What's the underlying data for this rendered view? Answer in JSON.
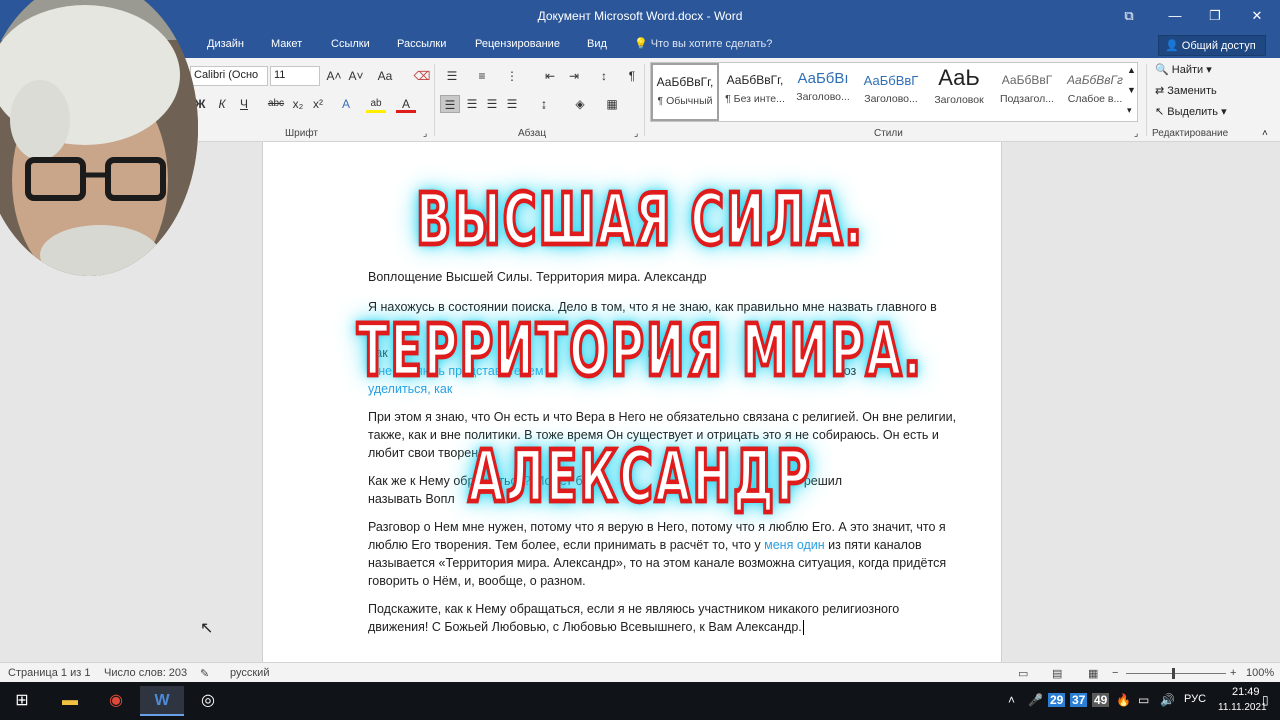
{
  "window": {
    "title": "Документ Microsoft Word.docx - Word",
    "controls": [
      "⧉",
      "—",
      "❐",
      "✕"
    ]
  },
  "tabs": {
    "items": [
      "Дизайн",
      "Макет",
      "Ссылки",
      "Рассылки",
      "Рецензирование",
      "Вид"
    ],
    "tell_me": "Что вы хотите сделать?",
    "share": "Общий доступ"
  },
  "ribbon": {
    "font": {
      "name": "Calibri (Осно",
      "size": "11",
      "label": "Шрифт",
      "grow": "A˄",
      "shrink": "A˅",
      "case": "Aa",
      "bold": "Ж",
      "italic": "К",
      "underline": "Ч",
      "strike": "abc",
      "sub": "x₂",
      "sup": "x²",
      "effects": "A",
      "highlight": "ab",
      "color": "A"
    },
    "paragraph": {
      "label": "Абзац",
      "marks": "¶"
    },
    "styles": {
      "label": "Стили",
      "items": [
        {
          "sample": "АаБбВвГг,",
          "name": "¶ Обычный"
        },
        {
          "sample": "АаБбВвГг,",
          "name": "¶ Без инте..."
        },
        {
          "sample": "АаБбВı",
          "name": "Заголово..."
        },
        {
          "sample": "АаБбВвГ",
          "name": "Заголово..."
        },
        {
          "sample": "АаЬ",
          "name": "Заголовок"
        },
        {
          "sample": "АаБбВвГ",
          "name": "Подзагол..."
        },
        {
          "sample": "АаБбВвГг",
          "name": "Слабое в..."
        }
      ]
    },
    "editing": {
      "label": "Редактирование",
      "find": "Найти",
      "replace": "Заменить",
      "select": "Выделить"
    }
  },
  "document": {
    "p1": "Воплощение Высшей Силы. Территория мира. Александр",
    "p2": "Я нахожусь в состоянии поиска. Дело в том, что я не знаю, как правильно мне назвать главного в",
    "p3a": "Как",
    "p3b": "к Не",
    "p3c": "я не являюсь представителем",
    "p3d": "поз",
    "p3e": "уделиться, как",
    "p4": "При этом я знаю, что Он есть и что Вера в Него не обязательно связана с религией. Он вне религии, также, как и вне политики. В тоже время Он существует и отрицать это я не собираюсь. Он есть и любит свои творения.",
    "p5a": "Как же к Нему обращаться? Может быть,",
    "p5b": "Его решил",
    "p5c": "называть Вопл",
    "p6a": "Разговор о Нем мне нужен, потому что я верую в Него, потому что я люблю Его. А это значит, что я люблю Его творения. Тем более, если принимать в расчёт то, что у",
    "p6b": "меня один",
    "p6c": "из пяти каналов называется «Территория мира. Александр», то на этом канале возможна ситуация, когда придётся говорить о Нём, и, вообще, о разном.",
    "p7": "Подскажите, как к Нему обращаться, если я не являюсь участником никакого религиозного движения! С Божьей Любовью, с Любовью Всевышнего, к Вам Александр."
  },
  "banner": {
    "line1": "ВЫСШАЯ  СИЛА.",
    "line2": "ТЕРРИТОРИЯ  МИРА.",
    "line3": "АЛЕКСАНДР"
  },
  "status": {
    "page": "Страница 1 из 1",
    "words": "Число слов: 203",
    "lang": "русский",
    "zoom": "100%"
  },
  "taskbar": {
    "tray_numbers": [
      "29",
      "37",
      "49"
    ],
    "tray_colors": [
      "#2a7fd4",
      "#2a7fd4",
      "#d9472b"
    ],
    "lang": "РУС",
    "time": "21:49",
    "date": "11.11.2021"
  }
}
